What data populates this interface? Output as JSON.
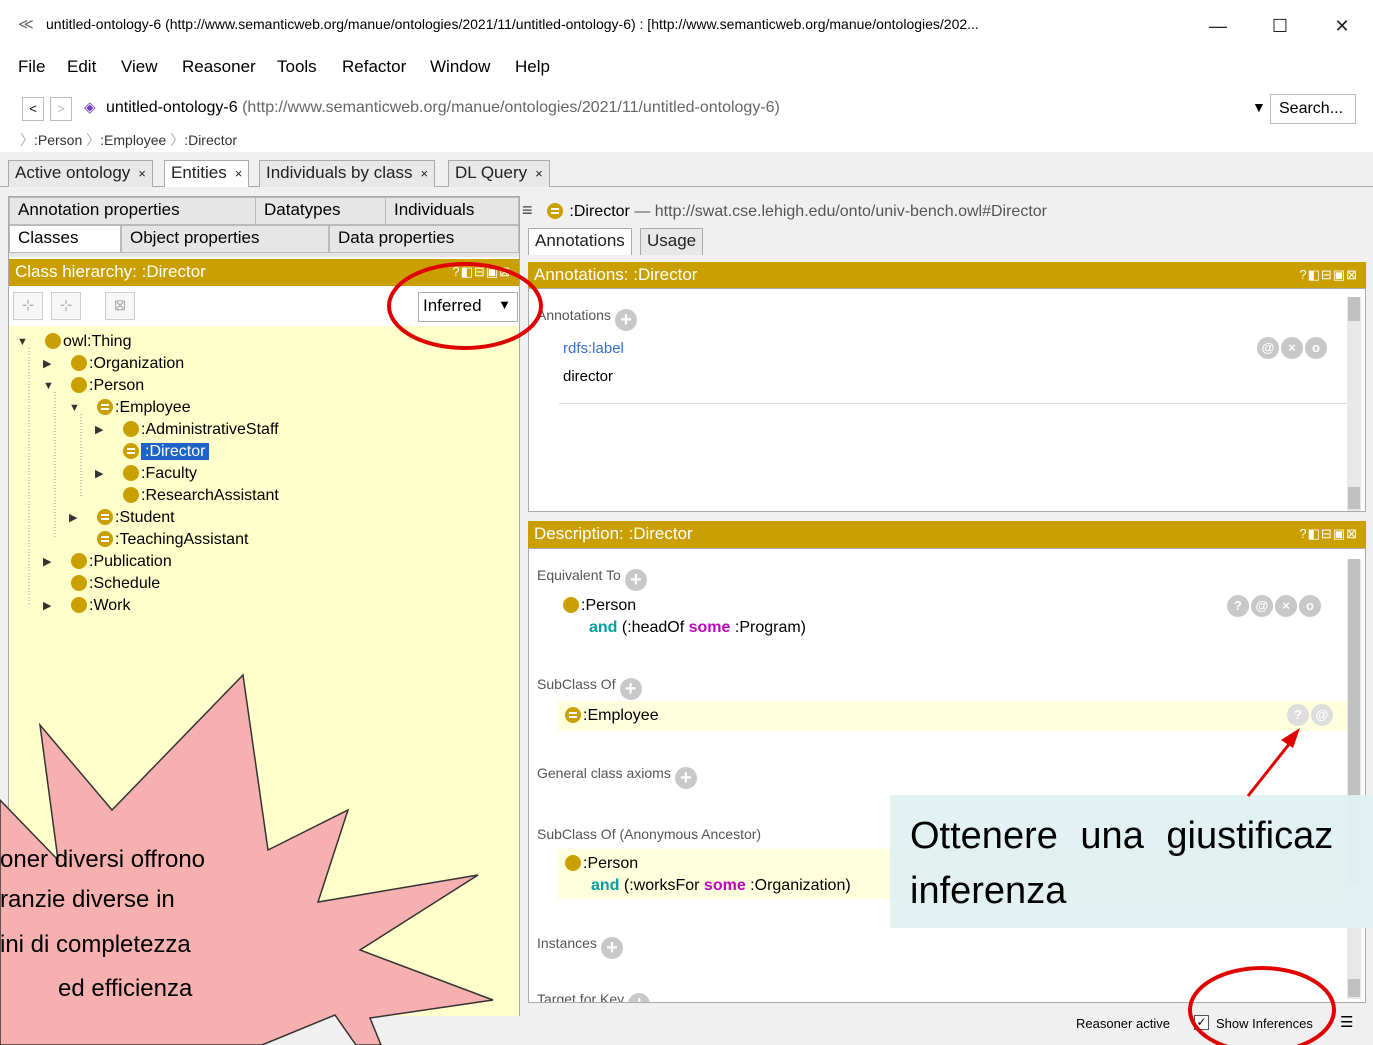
{
  "window": {
    "title": "untitled-ontology-6 (http://www.semanticweb.org/manue/ontologies/2021/11/untitled-ontology-6) : [http://www.semanticweb.org/manue/ontologies/202...",
    "minimize": "—",
    "maximize": "☐",
    "close": "✕"
  },
  "menu": [
    "File",
    "Edit",
    "View",
    "Reasoner",
    "Tools",
    "Refactor",
    "Window",
    "Help"
  ],
  "address": {
    "back": "<",
    "forward": ">",
    "ontology_name": "untitled-ontology-6",
    "ontology_iri": "(http://www.semanticweb.org/manue/ontologies/2021/11/untitled-ontology-6)",
    "search_label": "Search..."
  },
  "breadcrumbs": [
    ":Person",
    ":Employee",
    ":Director"
  ],
  "tabs": [
    {
      "label": "Active ontology",
      "close": "×"
    },
    {
      "label": "Entities",
      "close": "×"
    },
    {
      "label": "Individuals by class",
      "close": "×"
    },
    {
      "label": "DL Query",
      "close": "×"
    }
  ],
  "left_tabs": {
    "row1": [
      "Annotation properties",
      "Datatypes",
      "Individuals"
    ],
    "row2": [
      "Classes",
      "Object properties",
      "Data properties"
    ]
  },
  "class_hierarchy": {
    "header": "Class hierarchy: :Director",
    "header_buttons": "?◧⊟▣⊠",
    "mode": "Inferred",
    "nodes": [
      {
        "label": "owl:Thing",
        "toggle": "▼"
      },
      {
        "label": ":Organization",
        "toggle": "▶"
      },
      {
        "label": ":Person",
        "toggle": "▼"
      },
      {
        "label": ":Employee",
        "toggle": "▼"
      },
      {
        "label": ":AdministrativeStaff",
        "toggle": "▶"
      },
      {
        "label": ":Director",
        "toggle": ""
      },
      {
        "label": ":Faculty",
        "toggle": "▶"
      },
      {
        "label": ":ResearchAssistant",
        "toggle": ""
      },
      {
        "label": ":Student",
        "toggle": "▶"
      },
      {
        "label": ":TeachingAssistant",
        "toggle": ""
      },
      {
        "label": ":Publication",
        "toggle": "▶"
      },
      {
        "label": ":Schedule",
        "toggle": ""
      },
      {
        "label": ":Work",
        "toggle": "▶"
      }
    ]
  },
  "entity": {
    "name": ":Director",
    "dash": "—",
    "iri": "http://swat.cse.lehigh.edu/onto/univ-bench.owl#Director",
    "menu_icon": "≡"
  },
  "right_tabs": [
    "Annotations",
    "Usage"
  ],
  "annotations": {
    "header": "Annotations: :Director",
    "section": "Annotations",
    "property": "rdfs:label",
    "value": "director",
    "buttons": [
      "@",
      "×",
      "o"
    ]
  },
  "description": {
    "header": "Description: :Director",
    "equivalent_to": "Equivalent To",
    "equiv_class": ":Person",
    "equiv_and": "and",
    "equiv_open": "(:headOf",
    "equiv_some": "some",
    "equiv_close": ":Program)",
    "equiv_buttons": [
      "?",
      "@",
      "×",
      "o"
    ],
    "subclass_of": "SubClass Of",
    "subclass_value": ":Employee",
    "subclass_buttons": [
      "?",
      "@"
    ],
    "general_axioms": "General class axioms",
    "anon_ancestor": "SubClass Of (Anonymous Ancestor)",
    "anon_class": ":Person",
    "anon_and": "and",
    "anon_open": "(:worksFor",
    "anon_some": "some",
    "anon_close": ":Organization)",
    "instances": "Instances",
    "target_for_key": "Target for Key"
  },
  "status": {
    "reasoner": "Reasoner active",
    "show_inferences": "Show Inferences",
    "checkbox": "✓"
  },
  "callout": {
    "line1": "Ottenere una giustificaz",
    "line2": "inferenza"
  },
  "starburst": {
    "lines": [
      "oner diversi offrono",
      "ranzie diverse in",
      "ini di completezza",
      "ed efficienza"
    ]
  },
  "colors": {
    "header_gold": "#c9a000",
    "tree_bg": "#ffffcc",
    "annotation_red": "#e00000",
    "star_fill": "#f7b0b0",
    "selection": "#1e64c8"
  }
}
